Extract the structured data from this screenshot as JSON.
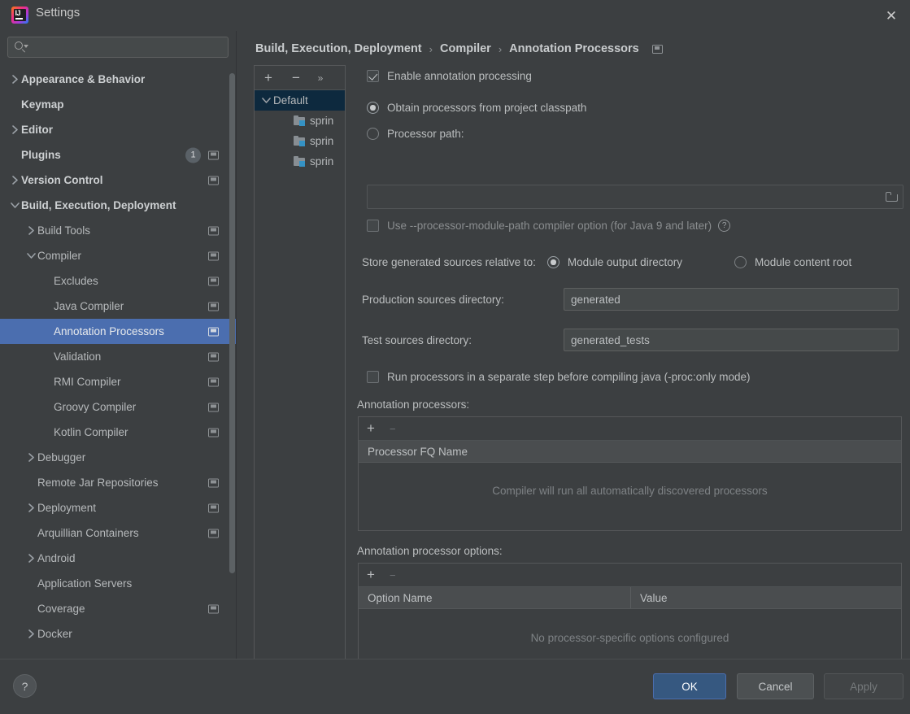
{
  "window": {
    "title": "Settings",
    "close_icon": "close-icon",
    "logo_text": "IJ"
  },
  "sidebar": {
    "search": {
      "placeholder": "",
      "value": "",
      "icon": "search-icon"
    },
    "items": [
      {
        "label": "Appearance & Behavior",
        "level": 0,
        "arrow": "collapsed",
        "top": true,
        "cfg": false,
        "badge": null,
        "selected": false
      },
      {
        "label": "Keymap",
        "level": 0,
        "arrow": "none",
        "top": true,
        "cfg": false,
        "badge": null,
        "selected": false
      },
      {
        "label": "Editor",
        "level": 0,
        "arrow": "collapsed",
        "top": true,
        "cfg": false,
        "badge": null,
        "selected": false
      },
      {
        "label": "Plugins",
        "level": 0,
        "arrow": "none",
        "top": true,
        "cfg": true,
        "badge": "1",
        "selected": false
      },
      {
        "label": "Version Control",
        "level": 0,
        "arrow": "collapsed",
        "top": true,
        "cfg": true,
        "badge": null,
        "selected": false
      },
      {
        "label": "Build, Execution, Deployment",
        "level": 0,
        "arrow": "expanded",
        "top": true,
        "cfg": false,
        "badge": null,
        "selected": false
      },
      {
        "label": "Build Tools",
        "level": 1,
        "arrow": "collapsed",
        "top": false,
        "cfg": true,
        "badge": null,
        "selected": false
      },
      {
        "label": "Compiler",
        "level": 1,
        "arrow": "expanded",
        "top": false,
        "cfg": true,
        "badge": null,
        "selected": false
      },
      {
        "label": "Excludes",
        "level": 2,
        "arrow": "none",
        "top": false,
        "cfg": true,
        "badge": null,
        "selected": false
      },
      {
        "label": "Java Compiler",
        "level": 2,
        "arrow": "none",
        "top": false,
        "cfg": true,
        "badge": null,
        "selected": false
      },
      {
        "label": "Annotation Processors",
        "level": 2,
        "arrow": "none",
        "top": false,
        "cfg": true,
        "badge": null,
        "selected": true
      },
      {
        "label": "Validation",
        "level": 2,
        "arrow": "none",
        "top": false,
        "cfg": true,
        "badge": null,
        "selected": false
      },
      {
        "label": "RMI Compiler",
        "level": 2,
        "arrow": "none",
        "top": false,
        "cfg": true,
        "badge": null,
        "selected": false
      },
      {
        "label": "Groovy Compiler",
        "level": 2,
        "arrow": "none",
        "top": false,
        "cfg": true,
        "badge": null,
        "selected": false
      },
      {
        "label": "Kotlin Compiler",
        "level": 2,
        "arrow": "none",
        "top": false,
        "cfg": true,
        "badge": null,
        "selected": false
      },
      {
        "label": "Debugger",
        "level": 1,
        "arrow": "collapsed",
        "top": false,
        "cfg": false,
        "badge": null,
        "selected": false
      },
      {
        "label": "Remote Jar Repositories",
        "level": 1,
        "arrow": "none",
        "top": false,
        "cfg": true,
        "badge": null,
        "selected": false
      },
      {
        "label": "Deployment",
        "level": 1,
        "arrow": "collapsed",
        "top": false,
        "cfg": true,
        "badge": null,
        "selected": false
      },
      {
        "label": "Arquillian Containers",
        "level": 1,
        "arrow": "none",
        "top": false,
        "cfg": true,
        "badge": null,
        "selected": false
      },
      {
        "label": "Android",
        "level": 1,
        "arrow": "collapsed",
        "top": false,
        "cfg": false,
        "badge": null,
        "selected": false
      },
      {
        "label": "Application Servers",
        "level": 1,
        "arrow": "none",
        "top": false,
        "cfg": false,
        "badge": null,
        "selected": false
      },
      {
        "label": "Coverage",
        "level": 1,
        "arrow": "none",
        "top": false,
        "cfg": true,
        "badge": null,
        "selected": false
      },
      {
        "label": "Docker",
        "level": 1,
        "arrow": "collapsed",
        "top": false,
        "cfg": false,
        "badge": null,
        "selected": false
      }
    ]
  },
  "breadcrumb": {
    "items": [
      "Build, Execution, Deployment",
      "Compiler",
      "Annotation Processors"
    ],
    "separator": "›"
  },
  "profiles": {
    "toolbar": {
      "add": "+",
      "remove": "−",
      "more": "»"
    },
    "root": {
      "label": "Default",
      "arrow": "expanded",
      "selected": true
    },
    "modules": [
      {
        "label": "sprin"
      },
      {
        "label": "sprin"
      },
      {
        "label": "sprin"
      }
    ]
  },
  "form": {
    "enable_annotation_processing": {
      "label": "Enable annotation processing",
      "checked": true
    },
    "obtain_from_classpath": {
      "label": "Obtain processors from project classpath",
      "selected": true
    },
    "processor_path": {
      "label": "Processor path:",
      "selected": false,
      "value": "",
      "placeholder": "",
      "browse_icon": "folder-browse-icon"
    },
    "module_path_option": {
      "label": "Use --processor-module-path compiler option (for Java 9 and later)",
      "checked": false,
      "help_icon": "help-question-icon"
    },
    "store_relative": {
      "label": "Store generated sources relative to:",
      "option_output": {
        "label": "Module output directory",
        "selected": true
      },
      "option_content": {
        "label": "Module content root",
        "selected": false
      }
    },
    "production_sources": {
      "label": "Production sources directory:",
      "value": "generated"
    },
    "test_sources": {
      "label": "Test sources directory:",
      "value": "generated_tests"
    },
    "separate_step": {
      "label": "Run processors in a separate step before compiling java (-proc:only mode)",
      "checked": false
    },
    "processors_table": {
      "section_label": "Annotation processors:",
      "columns": [
        "Processor FQ Name"
      ],
      "rows": [],
      "empty_text": "Compiler will run all automatically discovered processors",
      "add": "+",
      "remove": "−"
    },
    "options_table": {
      "section_label": "Annotation processor options:",
      "columns": [
        "Option Name",
        "Value"
      ],
      "rows": [],
      "empty_text": "No processor-specific options configured",
      "add": "+",
      "remove": "−"
    }
  },
  "footer": {
    "help_label": "?",
    "ok": "OK",
    "cancel": "Cancel",
    "apply": "Apply"
  },
  "colors": {
    "accent_selection": "#4b6eaf",
    "primary_button": "#365880",
    "module_badge": "#3592c4",
    "background": "#3c3f41"
  }
}
